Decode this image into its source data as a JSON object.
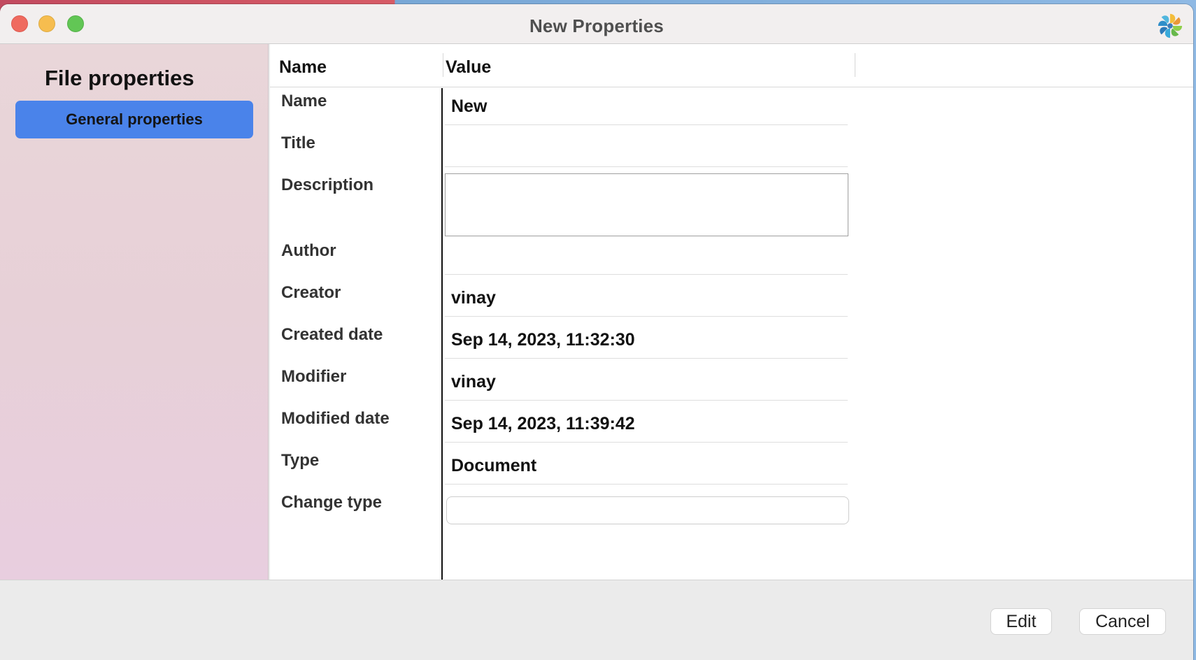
{
  "window": {
    "title": "New Properties"
  },
  "sidebar": {
    "heading": "File properties",
    "items": [
      {
        "label": "General properties"
      }
    ]
  },
  "table": {
    "headers": {
      "name": "Name",
      "value": "Value"
    },
    "rows": [
      {
        "label": "Name",
        "value": "New"
      },
      {
        "label": "Title",
        "value": ""
      },
      {
        "label": "Description",
        "value": ""
      },
      {
        "label": "Author",
        "value": ""
      },
      {
        "label": "Creator",
        "value": "vinay"
      },
      {
        "label": "Created date",
        "value": "Sep 14, 2023, 11:32:30"
      },
      {
        "label": "Modifier",
        "value": "vinay"
      },
      {
        "label": "Modified date",
        "value": "Sep 14, 2023, 11:39:42"
      },
      {
        "label": "Type",
        "value": "Document"
      },
      {
        "label": "Change type",
        "value": ""
      }
    ]
  },
  "footer": {
    "edit_label": "Edit",
    "cancel_label": "Cancel"
  },
  "colors": {
    "accent": "#4a83ea",
    "window_background": "#ececec",
    "sidebar_background": "#e7d0d7"
  },
  "icons": {
    "app_logo": "pinwheel-logo"
  }
}
